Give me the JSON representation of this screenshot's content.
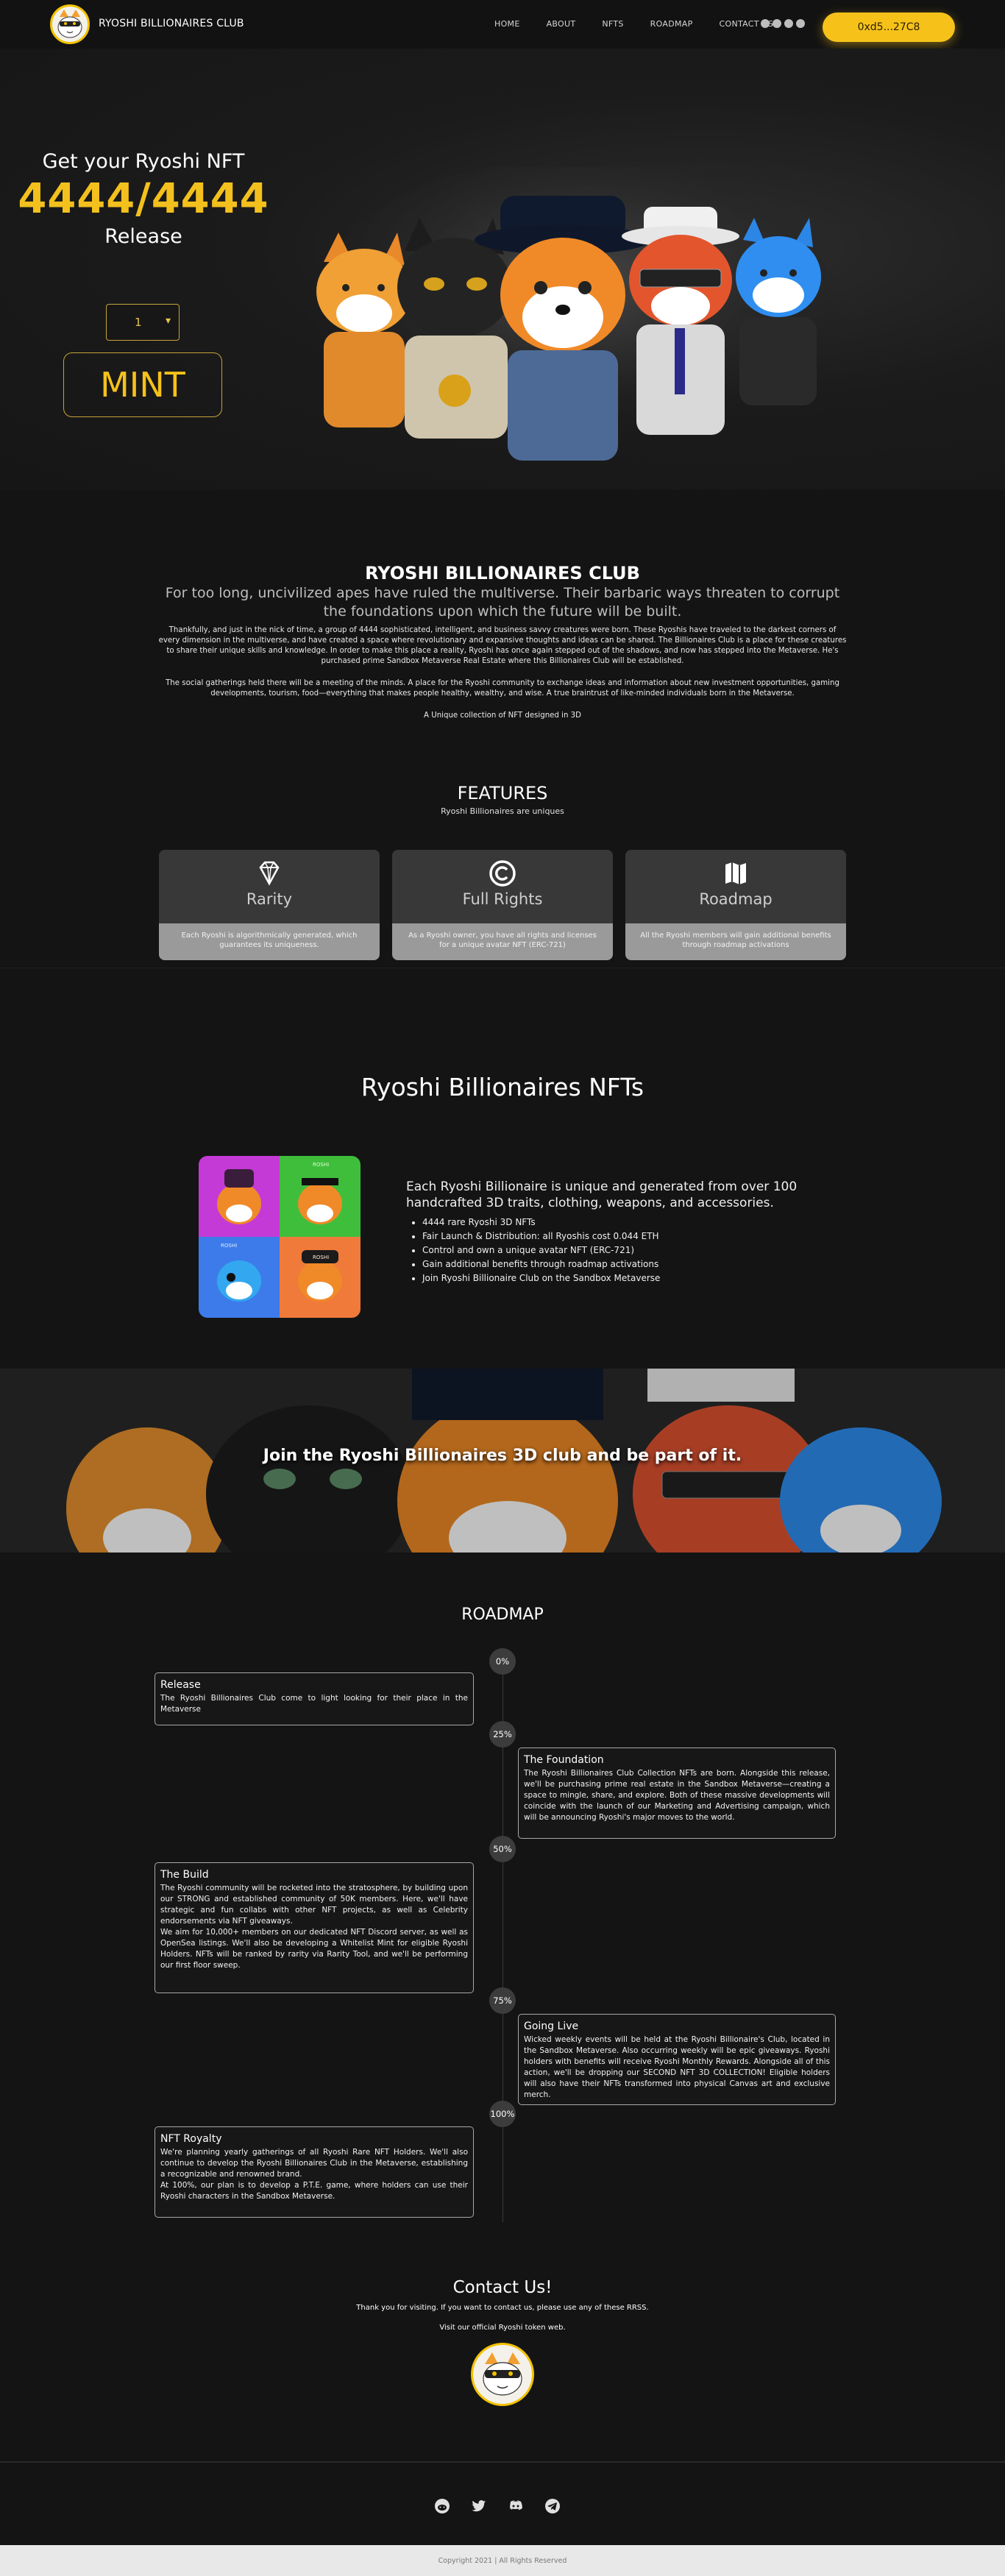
{
  "nav": {
    "brand": "RYOSHI BILLIONAIRES CLUB",
    "links": [
      "HOME",
      "ABOUT",
      "NFTS",
      "ROADMAP",
      "CONTACT US"
    ],
    "wallet": "0xd5...27C8"
  },
  "hero": {
    "get": "Get your Ryoshi NFT",
    "count": "4444/4444",
    "release": "Release",
    "quantity": "1",
    "mint": "MINT"
  },
  "about": {
    "title": "RYOSHI BILLIONAIRES CLUB",
    "subtitle": "For too long, uncivilized apes have ruled the multiverse. Their barbaric ways threaten to corrupt the foundations upon which the future will be built.",
    "p1": "Thankfully, and just in the nick of time, a group of 4444 sophisticated, intelligent, and business savvy creatures were born. These Ryoshis have traveled to the darkest corners of every dimension in the multiverse, and have created a space where revolutionary and expansive thoughts and ideas can be shared. The Billionaires Club is a place for these creatures to share their unique skills and knowledge. In order to make this place a reality, Ryoshi has once again stepped out of the shadows, and now has stepped into the Metaverse. He's purchased prime Sandbox Metaverse Real Estate where this Billionaires Club will be established.",
    "p2": "The social gatherings held there will be a meeting of the minds. A place for the Ryoshi community to exchange ideas and information about new investment opportunities, gaming developments, tourism, food—everything that makes people healthy, wealthy, and wise. A true braintrust of like-minded individuals born in the Metaverse.",
    "p3": "A Unique collection of NFT designed in 3D"
  },
  "features": {
    "title": "FEATURES",
    "subtitle": "Ryoshi Billionaires are uniques",
    "cards": [
      {
        "label": "Rarity",
        "icon": "diamond-icon",
        "desc": "Each Ryoshi is algorithmically generated, which guarantees its uniqueness."
      },
      {
        "label": "Full Rights",
        "icon": "copyright-icon",
        "desc": "As a Ryoshi owner, you have all rights and licenses for a unique avatar NFT (ERC-721)"
      },
      {
        "label": "Roadmap",
        "icon": "map-icon",
        "desc": "All the Ryoshi members will gain additional benefits through roadmap activations"
      }
    ]
  },
  "nfts": {
    "title": "Ryoshi Billionaires NFTs",
    "headline": "Each Ryoshi Billionaire is unique and generated from over 100 handcrafted 3D traits, clothing, weapons, and accessories.",
    "bullets": [
      "4444 rare Ryoshi 3D NFTs",
      "Fair Launch & Distribution: all Ryoshis cost 0.044 ETH",
      "Control and own a unique avatar NFT (ERC-721)",
      "Gain additional benefits through roadmap activations",
      "Join Ryoshi Billionaire Club on the Sandbox Metaverse"
    ],
    "collage_tags": [
      "ROSHI",
      "ROSHI",
      "ROSHI"
    ]
  },
  "banner": {
    "text": "Join the Ryoshi Billionaires 3D club and be part of it."
  },
  "roadmap": {
    "title": "ROADMAP",
    "percents": [
      "0%",
      "25%",
      "50%",
      "75%",
      "100%"
    ],
    "items": [
      {
        "title": "Release",
        "body": "The Ryoshi Billionaires Club come to light looking for their place in the Metaverse"
      },
      {
        "title": "The Foundation",
        "body": "The Ryoshi Billionaires Club Collection NFTs are born. Alongside this release, we'll be purchasing prime real estate in the Sandbox Metaverse—creating a space to mingle, share, and explore. Both of these massive developments will coincide with the launch of our Marketing and Advertising campaign, which will be announcing Ryoshi's major moves to the world."
      },
      {
        "title": "The Build",
        "body": "The Ryoshi community will be rocketed into the stratosphere, by building upon our STRONG and established community of 50K members. Here, we'll have strategic and fun collabs with other NFT projects, as well as Celebrity endorsements via NFT giveaways.",
        "body2": "We aim for 10,000+ members on our dedicated NFT Discord server, as well as OpenSea listings. We'll also be developing a Whitelist Mint for eligible Ryoshi Holders. NFTs will be ranked by rarity via Rarity Tool, and we'll be performing our first floor sweep."
      },
      {
        "title": "Going Live",
        "body": "Wicked weekly events will be held at the Ryoshi Billionaire's Club, located in the Sandbox Metaverse. Also occurring weekly will be epic giveaways. Ryoshi holders with benefits will receive Ryoshi Monthly Rewards. Alongside all of this action, we'll be dropping our SECOND NFT 3D COLLECTION! Eligible holders will also have their NFTs transformed into physical Canvas art and exclusive merch."
      },
      {
        "title": "NFT Royalty",
        "body": "We're planning yearly gatherings of all Ryoshi Rare NFT Holders. We'll also continue to develop the Ryoshi Billionaires Club in the Metaverse, establishing a recognizable and renowned brand.",
        "body2": "At 100%, our plan is to develop a P.T.E. game, where holders can use their Ryoshi characters in the Sandbox Metaverse."
      }
    ]
  },
  "contact": {
    "title": "Contact Us!",
    "p1": "Thank you for visiting. If you want to contact us, please use any of these RRSS.",
    "p2": "Visit our official Ryoshi token web."
  },
  "footer": {
    "icons": [
      "reddit-icon",
      "twitter-icon",
      "discord-icon",
      "telegram-icon"
    ],
    "copyright": "Copyright 2021 | All Rights Reserved"
  },
  "colors": {
    "accent": "#f6c21a",
    "background": "#141414"
  }
}
